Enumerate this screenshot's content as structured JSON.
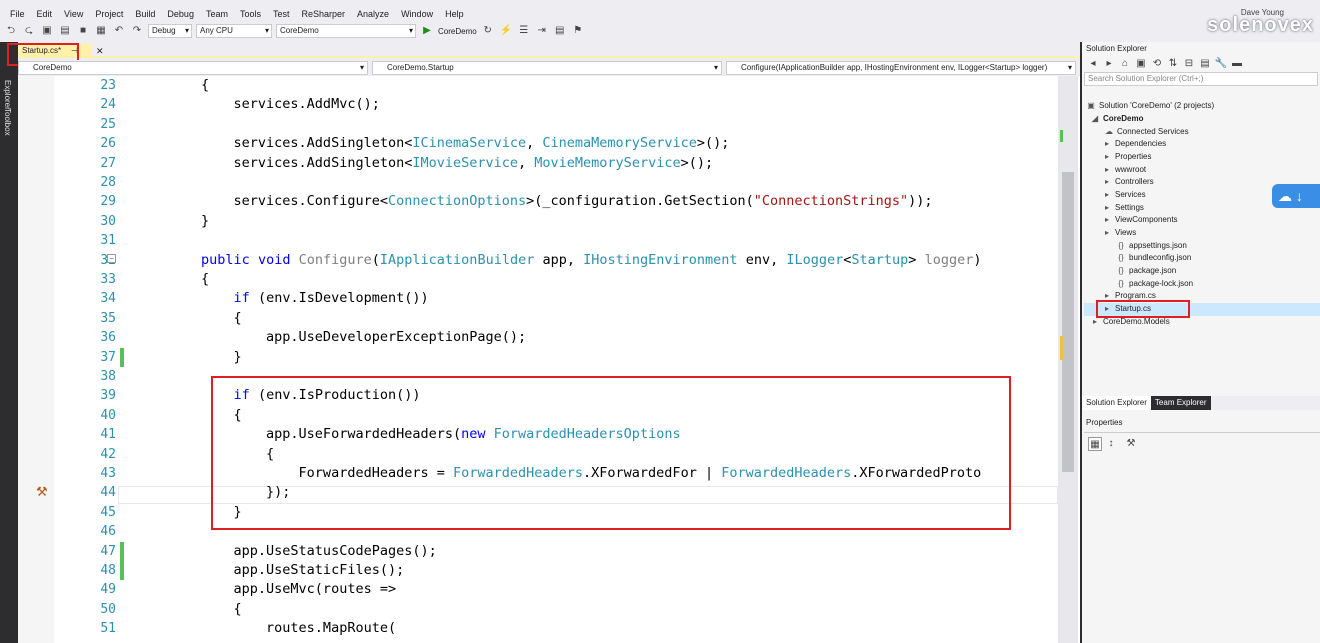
{
  "menu": [
    "File",
    "Edit",
    "View",
    "Project",
    "Build",
    "Debug",
    "Team",
    "Tools",
    "Test",
    "ReSharper",
    "Analyze",
    "Window",
    "Help"
  ],
  "user": "Dave Young",
  "watermark": "solenovex",
  "toolbar": {
    "config": "Debug",
    "platform": "Any CPU",
    "project": "CoreDemo",
    "run_label": "CoreDemo"
  },
  "side_tabs": [
    "Explorer",
    "Toolbox"
  ],
  "tab": {
    "label": "Startup.cs*"
  },
  "nav": {
    "project": "CoreDemo",
    "class": "CoreDemo.Startup",
    "member": "Configure(IApplicationBuilder app, IHostingEnvironment env, ILogger<Startup> logger)"
  },
  "line_numbers": [
    "23",
    "24",
    "25",
    "26",
    "27",
    "28",
    "29",
    "30",
    "31",
    "32",
    "33",
    "34",
    "35",
    "36",
    "37",
    "38",
    "39",
    "40",
    "41",
    "42",
    "43",
    "44",
    "45",
    "46",
    "47",
    "48",
    "49",
    "50",
    "51"
  ],
  "solution": {
    "title": "Solution Explorer",
    "search_placeholder": "Search Solution Explorer (Ctrl+;)",
    "items": [
      "Solution 'CoreDemo' (2 projects)",
      "CoreDemo",
      "Connected Services",
      "Dependencies",
      "Properties",
      "wwwroot",
      "Controllers",
      "Services",
      "Settings",
      "ViewComponents",
      "Views",
      "appsettings.json",
      "bundleconfig.json",
      "package.json",
      "package-lock.json",
      "Program.cs",
      "Startup.cs",
      "CoreDemo.Models"
    ],
    "tab_solution": "Solution Explorer",
    "tab_team": "Team Explorer"
  },
  "properties": {
    "title": "Properties"
  }
}
